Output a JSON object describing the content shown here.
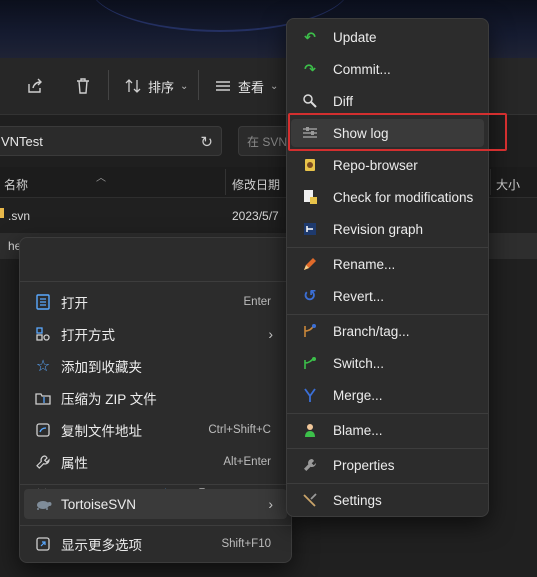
{
  "toolbar": {
    "sort_label": "排序",
    "view_label": "查看"
  },
  "address": {
    "path": "VNTest",
    "search_placeholder": "在 SVN"
  },
  "list_header": {
    "name": "名称",
    "modified": "修改日期",
    "size": "大小"
  },
  "files": [
    {
      "name": ".svn",
      "date": "2023/5/7"
    },
    {
      "name": "he",
      "date": ""
    }
  ],
  "shell_menu": {
    "quick_actions": [
      "cut-icon",
      "copy-icon",
      "rename-icon",
      "share-icon",
      "delete-icon"
    ],
    "items": [
      {
        "label": "打开",
        "shortcut": "Enter"
      },
      {
        "label": "打开方式",
        "shortcut": ""
      },
      {
        "label": "添加到收藏夹",
        "shortcut": ""
      },
      {
        "label": "压缩为 ZIP 文件",
        "shortcut": ""
      },
      {
        "label": "复制文件地址",
        "shortcut": "Ctrl+Shift+C"
      },
      {
        "label": "属性",
        "shortcut": "Alt+Enter"
      },
      {
        "label": "TortoiseSVN",
        "shortcut": ""
      },
      {
        "label": "显示更多选项",
        "shortcut": "Shift+F10"
      }
    ]
  },
  "svn_menu": {
    "items": [
      {
        "label": "Update"
      },
      {
        "label": "Commit..."
      },
      {
        "label": "Diff"
      },
      {
        "label": "Show log"
      },
      {
        "label": "Repo-browser"
      },
      {
        "label": "Check for modifications"
      },
      {
        "label": "Revision graph"
      },
      {
        "label": "Rename..."
      },
      {
        "label": "Revert..."
      },
      {
        "label": "Branch/tag..."
      },
      {
        "label": "Switch..."
      },
      {
        "label": "Merge..."
      },
      {
        "label": "Blame..."
      },
      {
        "label": "Properties"
      },
      {
        "label": "Settings"
      }
    ]
  },
  "colors": {
    "highlight_box": "#d32f2f",
    "accent": "#4aa3ff"
  }
}
